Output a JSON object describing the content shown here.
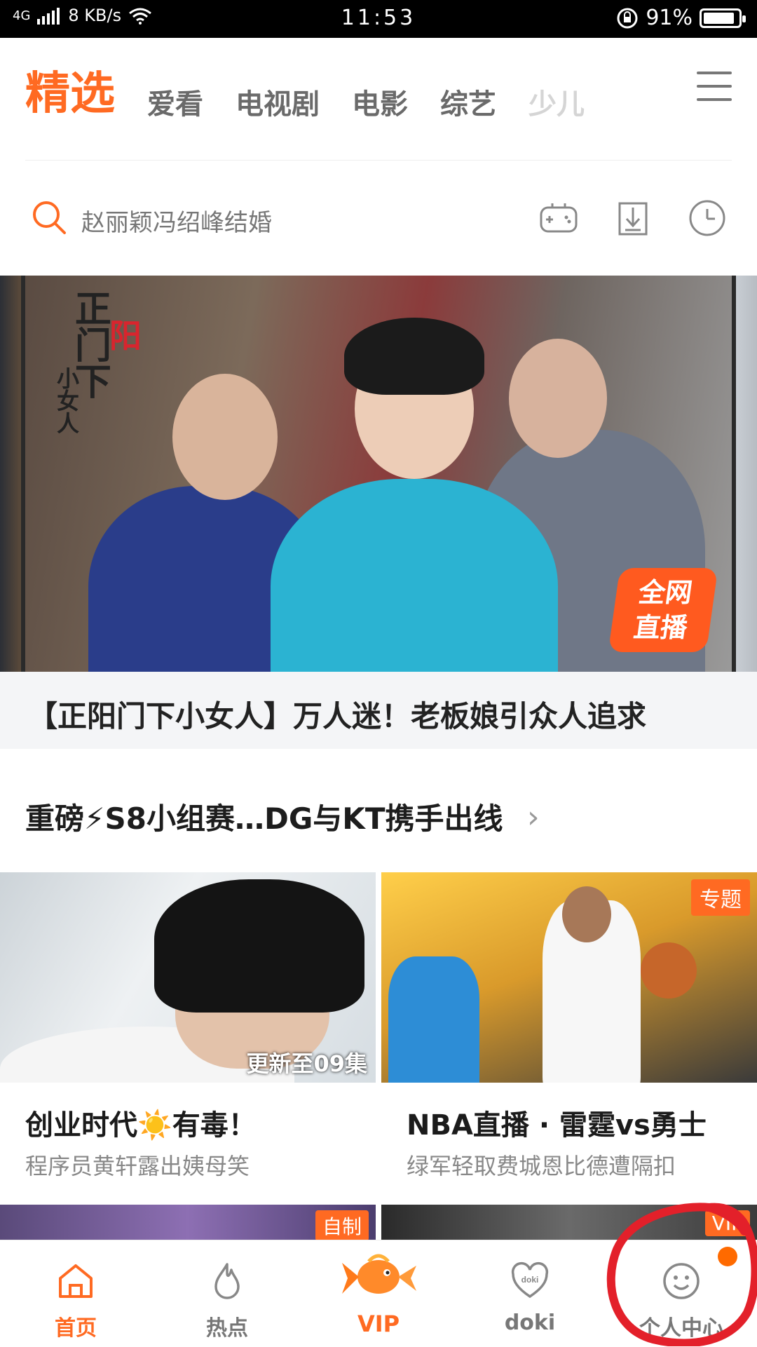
{
  "status": {
    "signal_text": "4G",
    "speed": "8 KB/s",
    "time": "11:53",
    "battery": "91%",
    "battery_level": 0.91
  },
  "nav": {
    "tabs": [
      "精选",
      "爱看",
      "电视剧",
      "电影",
      "综艺",
      "少儿"
    ],
    "active": 0
  },
  "search": {
    "placeholder": "赵丽颖冯绍峰结婚"
  },
  "banner": {
    "title_vertical": "正门下",
    "accent": "阳",
    "sub_vertical": "小女人",
    "live_badge": "全网\n直播",
    "caption": "【正阳门下小女人】万人迷！老板娘引众人追求"
  },
  "section": {
    "title": "重磅⚡S8小组赛…DG与KT携手出线"
  },
  "cards": [
    {
      "overlay": "更新至09集",
      "title": "创业时代☀️有毒！",
      "subtitle": "程序员黄轩露出姨母笑"
    },
    {
      "tag": "专题",
      "title": "NBA直播 · 雷霆vs勇士",
      "subtitle": "绿军轻取费城恩比德遭隔扣"
    }
  ],
  "row2": {
    "left_tag": "自制",
    "right_tag": "VIP"
  },
  "bottomnav": {
    "items": [
      "首页",
      "热点",
      "VIP",
      "doki",
      "个人中心"
    ],
    "active": 0
  },
  "colors": {
    "accent": "#ff6a22",
    "annotation": "#e3202a"
  }
}
